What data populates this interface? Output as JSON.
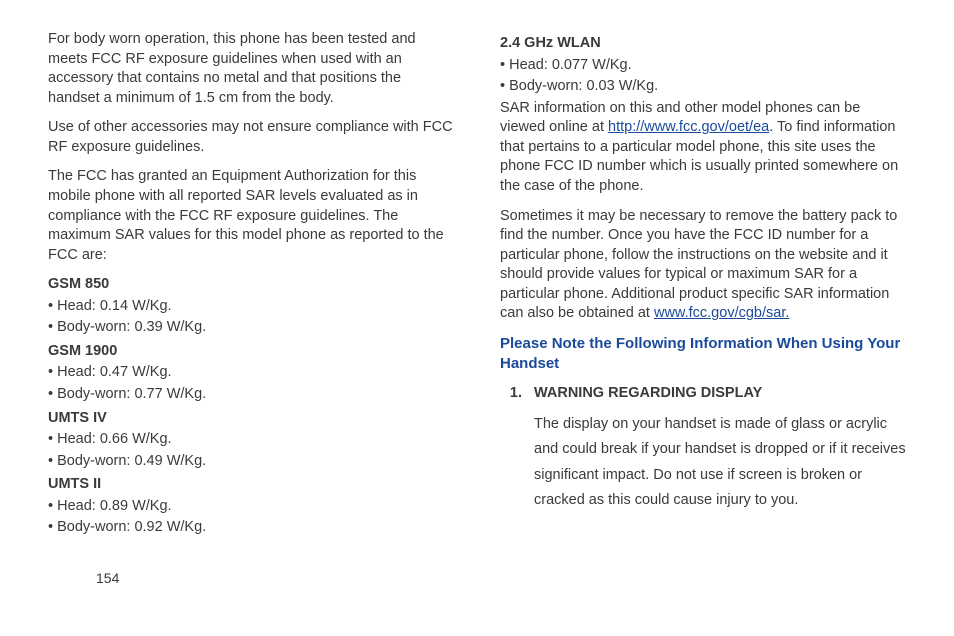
{
  "page_number": "154",
  "left": {
    "p1": "For body worn operation, this phone has been tested and meets FCC RF exposure guidelines when used with an accessory that contains no metal and that positions the handset a minimum of 1.5 cm from the body.",
    "p2": "Use of other accessories may not ensure compliance with FCC RF exposure guidelines.",
    "p3": "The FCC has granted an Equipment Authorization for this mobile phone with all reported SAR levels evaluated as in compliance with the FCC RF exposure guidelines. The maximum SAR values for this model phone as reported to the FCC are:",
    "gsm850": {
      "title": "GSM 850",
      "head": "• Head: 0.14 W/Kg.",
      "body": "• Body-worn: 0.39 W/Kg."
    },
    "gsm1900": {
      "title": "GSM 1900",
      "head": "• Head: 0.47 W/Kg.",
      "body": "• Body-worn: 0.77 W/Kg."
    },
    "umts4": {
      "title": "UMTS IV",
      "head": "• Head: 0.66 W/Kg.",
      "body": "• Body-worn: 0.49 W/Kg."
    },
    "umts2": {
      "title": "UMTS II",
      "head": "• Head: 0.89 W/Kg.",
      "body": "• Body-worn: 0.92 W/Kg."
    }
  },
  "right": {
    "wlan": {
      "title": "2.4 GHz WLAN",
      "head": "• Head: 0.077 W/Kg.",
      "body": "• Body-worn: 0.03 W/Kg."
    },
    "p1a": "SAR information on this and other model phones can be viewed online at  ",
    "link1": "http://www.fcc.gov/oet/ea",
    "p1b": ". To find information that pertains to a particular model phone, this site uses the phone FCC ID number which is usually printed somewhere on the case of the phone.",
    "p2a": "Sometimes it may be necessary to remove the battery pack to find the number. Once you have the FCC ID number for a particular phone, follow the instructions on the website and it should provide values for typical or maximum SAR for a particular phone. Additional product specific SAR information can also be obtained at  ",
    "link2": "www.fcc.gov/cgb/sar.",
    "section_title": "Please Note the Following Information When Using Your Handset",
    "item1": {
      "num": "1.",
      "label": "WARNING REGARDING DISPLAY",
      "body": "The display on your handset is made of glass or acrylic and could break if your handset is dropped or if it receives significant impact. Do not use if screen is broken or cracked as this could cause injury to you."
    }
  }
}
